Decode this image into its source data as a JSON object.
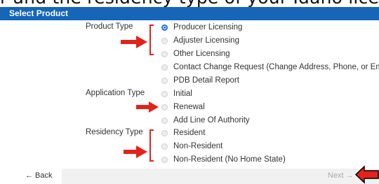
{
  "top_caption": "r and the residency type of your Idaho license.",
  "header": {
    "title": "Select Product"
  },
  "product_type": {
    "label": "Product Type",
    "options": [
      "Producer Licensing",
      "Adjuster Licensing",
      "Other Licensing",
      "Contact Change Request (Change Address, Phone, or Email)",
      "PDB Detail Report"
    ],
    "selected": "Producer Licensing"
  },
  "application_type": {
    "label": "Application Type",
    "options": [
      "Initial",
      "Renewal",
      "Add Line Of Authority"
    ]
  },
  "residency_type": {
    "label": "Residency Type",
    "options": [
      "Resident",
      "Non-Resident",
      "Non-Resident (No Home State)"
    ]
  },
  "footer": {
    "back_label": "← Back",
    "next_label": "Next →"
  },
  "colors": {
    "header": "#1565b8",
    "annotation": "#e3221b",
    "radio_selected": "#1a73d9"
  }
}
